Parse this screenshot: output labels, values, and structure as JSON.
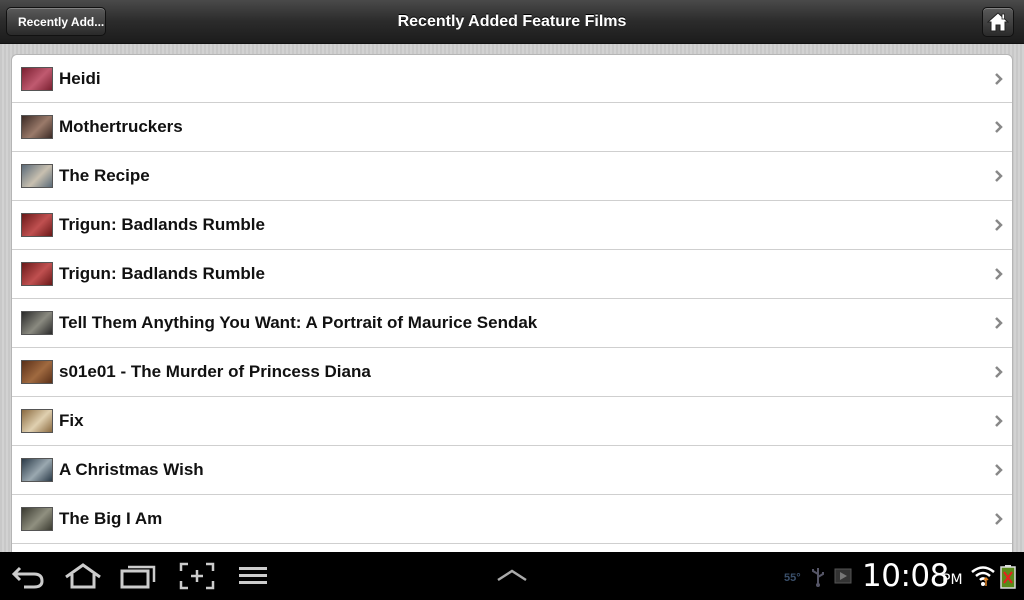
{
  "header": {
    "back_label": "Recently Add...",
    "title": "Recently Added Feature Films",
    "home_icon": "home-icon"
  },
  "films": [
    {
      "title": "Heidi",
      "thumb": [
        "#7a2030",
        "#c05a70"
      ]
    },
    {
      "title": "Mothertruckers",
      "thumb": [
        "#3b2a25",
        "#9a7a6a"
      ]
    },
    {
      "title": "The Recipe",
      "thumb": [
        "#5a6a78",
        "#c8c0b0"
      ]
    },
    {
      "title": "Trigun: Badlands Rumble",
      "thumb": [
        "#6a1818",
        "#c05050"
      ]
    },
    {
      "title": "Trigun: Badlands Rumble",
      "thumb": [
        "#6a1818",
        "#c05050"
      ]
    },
    {
      "title": "Tell Them Anything You Want: A Portrait of Maurice Sendak",
      "thumb": [
        "#2a2a2a",
        "#8a8a80"
      ]
    },
    {
      "title": "s01e01 - The Murder of Princess Diana",
      "thumb": [
        "#5a3018",
        "#a06a40"
      ]
    },
    {
      "title": "Fix",
      "thumb": [
        "#8a6a40",
        "#e0d0b0"
      ]
    },
    {
      "title": "A Christmas Wish",
      "thumb": [
        "#2a3a48",
        "#9aa8b0"
      ]
    },
    {
      "title": "The Big I Am",
      "thumb": [
        "#3a3a30",
        "#909080"
      ]
    }
  ],
  "status_bar": {
    "temperature": "55°",
    "time": "10:08",
    "ampm": "PM"
  },
  "colors": {
    "header_bg": "#2b2b2b",
    "list_bg": "#ffffff",
    "chevron": "#888888"
  }
}
